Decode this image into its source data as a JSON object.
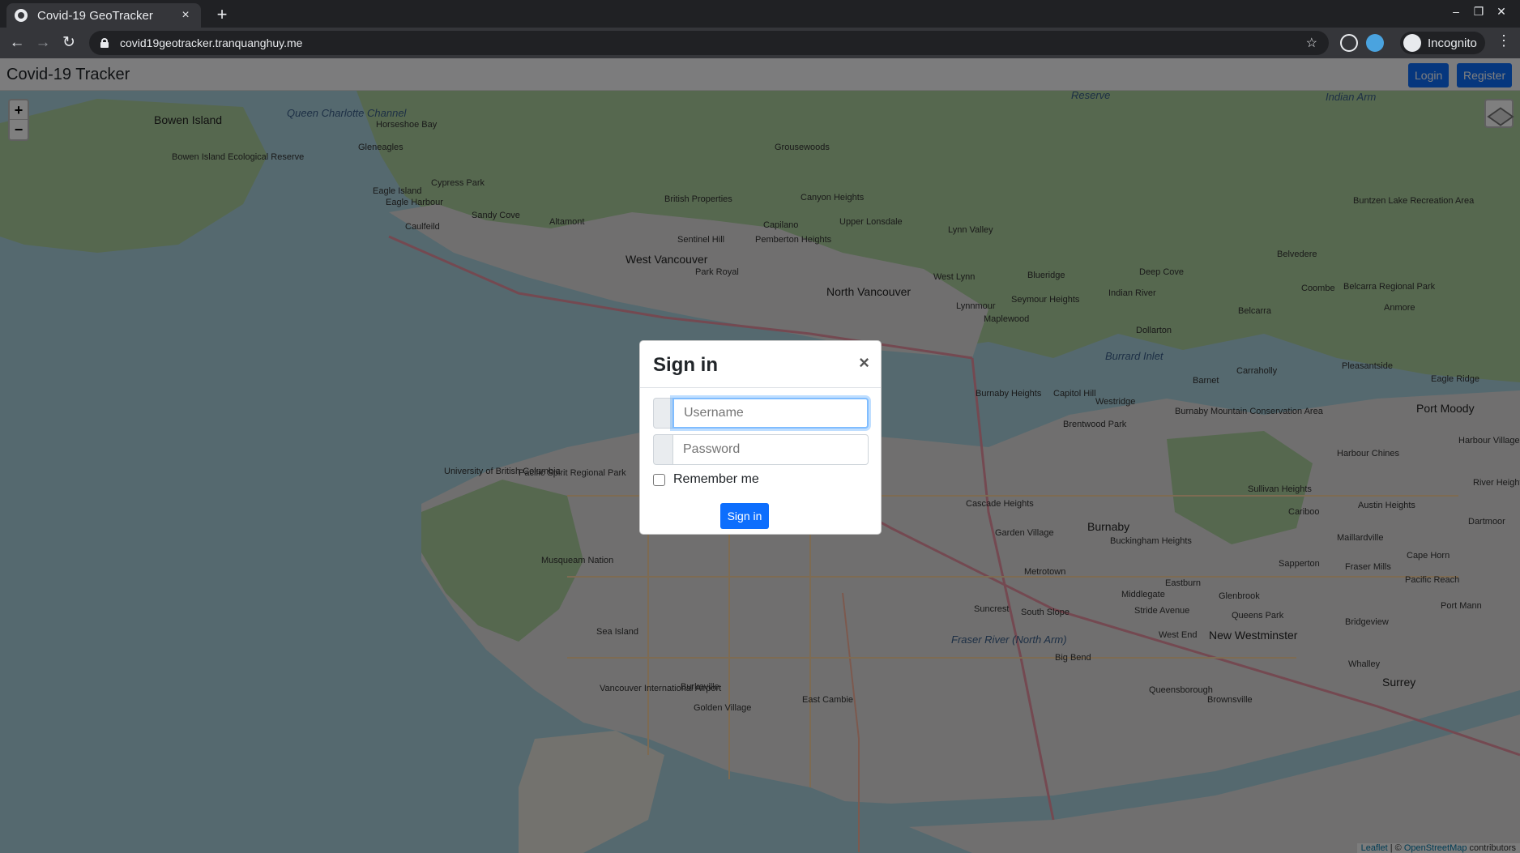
{
  "browser": {
    "tab_title": "Covid-19 GeoTracker",
    "tab_close": "×",
    "new_tab": "+",
    "url": "covid19geotracker.tranquanghuy.me",
    "profile_label": "Incognito"
  },
  "navbar": {
    "brand": "Covid-19 Tracker",
    "login_label": "Login",
    "register_label": "Register"
  },
  "map": {
    "zoom_in": "+",
    "zoom_out": "−",
    "attribution_leaflet": "Leaflet",
    "attribution_sep": " | © ",
    "attribution_osm": "OpenStreetMap",
    "attribution_tail": " contributors",
    "labels": [
      {
        "text": "Bowen Island",
        "kind": "big"
      },
      {
        "text": "Queen Charlotte Channel",
        "kind": "water"
      },
      {
        "text": "Horseshoe Bay",
        "kind": "normal"
      },
      {
        "text": "Gleneagles",
        "kind": "normal"
      },
      {
        "text": "Cypress Park",
        "kind": "normal"
      },
      {
        "text": "Eagle Island",
        "kind": "normal"
      },
      {
        "text": "Eagle Harbour",
        "kind": "normal"
      },
      {
        "text": "Caulfeild",
        "kind": "normal"
      },
      {
        "text": "Sandy Cove",
        "kind": "normal"
      },
      {
        "text": "Altamont",
        "kind": "normal"
      },
      {
        "text": "Grousewoods",
        "kind": "normal"
      },
      {
        "text": "British Properties",
        "kind": "normal"
      },
      {
        "text": "Canyon Heights",
        "kind": "normal"
      },
      {
        "text": "Capilano",
        "kind": "normal"
      },
      {
        "text": "Upper Lonsdale",
        "kind": "normal"
      },
      {
        "text": "Sentinel Hill",
        "kind": "normal"
      },
      {
        "text": "Pemberton Heights",
        "kind": "normal"
      },
      {
        "text": "Lynn Valley",
        "kind": "normal"
      },
      {
        "text": "West Vancouver",
        "kind": "big"
      },
      {
        "text": "Park Royal",
        "kind": "normal"
      },
      {
        "text": "North Vancouver",
        "kind": "big"
      },
      {
        "text": "West Lynn",
        "kind": "normal"
      },
      {
        "text": "Lynnmour",
        "kind": "normal"
      },
      {
        "text": "Maplewood",
        "kind": "normal"
      },
      {
        "text": "Blueridge",
        "kind": "normal"
      },
      {
        "text": "Seymour Heights",
        "kind": "normal"
      },
      {
        "text": "Indian River",
        "kind": "normal"
      },
      {
        "text": "Deep Cove",
        "kind": "normal"
      },
      {
        "text": "Belvedere",
        "kind": "normal"
      },
      {
        "text": "Coombe",
        "kind": "normal"
      },
      {
        "text": "Belcarra",
        "kind": "normal"
      },
      {
        "text": "Anmore",
        "kind": "normal"
      },
      {
        "text": "Dollarton",
        "kind": "normal"
      },
      {
        "text": "Burrard Inlet",
        "kind": "water"
      },
      {
        "text": "Pleasantside",
        "kind": "normal"
      },
      {
        "text": "Carraholly",
        "kind": "normal"
      },
      {
        "text": "Barnet",
        "kind": "normal"
      },
      {
        "text": "Eagle Ridge",
        "kind": "normal"
      },
      {
        "text": "Port Moody",
        "kind": "big"
      },
      {
        "text": "Burnaby Heights",
        "kind": "normal"
      },
      {
        "text": "Capitol Hill",
        "kind": "normal"
      },
      {
        "text": "Westridge",
        "kind": "normal"
      },
      {
        "text": "Brentwood Park",
        "kind": "normal"
      },
      {
        "text": "Harbour Chines",
        "kind": "normal"
      },
      {
        "text": "Harbour Village",
        "kind": "normal"
      },
      {
        "text": "River Heights",
        "kind": "normal"
      },
      {
        "text": "Sullivan Heights",
        "kind": "normal"
      },
      {
        "text": "Cariboo",
        "kind": "normal"
      },
      {
        "text": "Austin Heights",
        "kind": "normal"
      },
      {
        "text": "Dartmoor",
        "kind": "normal"
      },
      {
        "text": "Cascade Heights",
        "kind": "normal"
      },
      {
        "text": "Burnaby",
        "kind": "big"
      },
      {
        "text": "Garden Village",
        "kind": "normal"
      },
      {
        "text": "Buckingham Heights",
        "kind": "normal"
      },
      {
        "text": "Maillardville",
        "kind": "normal"
      },
      {
        "text": "Cape Horn",
        "kind": "normal"
      },
      {
        "text": "Sapperton",
        "kind": "normal"
      },
      {
        "text": "Fraser Mills",
        "kind": "normal"
      },
      {
        "text": "Pacific Reach",
        "kind": "normal"
      },
      {
        "text": "Metrotown",
        "kind": "normal"
      },
      {
        "text": "Eastburn",
        "kind": "normal"
      },
      {
        "text": "Middlegate",
        "kind": "normal"
      },
      {
        "text": "Glenbrook",
        "kind": "normal"
      },
      {
        "text": "Stride Avenue",
        "kind": "normal"
      },
      {
        "text": "Queens Park",
        "kind": "normal"
      },
      {
        "text": "Suncrest",
        "kind": "normal"
      },
      {
        "text": "South Slope",
        "kind": "normal"
      },
      {
        "text": "West End",
        "kind": "normal"
      },
      {
        "text": "New Westminster",
        "kind": "big"
      },
      {
        "text": "Bridgeview",
        "kind": "normal"
      },
      {
        "text": "Port Mann",
        "kind": "normal"
      },
      {
        "text": "Big Bend",
        "kind": "normal"
      },
      {
        "text": "Whalley",
        "kind": "normal"
      },
      {
        "text": "Surrey",
        "kind": "big"
      },
      {
        "text": "Queensborough",
        "kind": "normal"
      },
      {
        "text": "Brownsville",
        "kind": "normal"
      },
      {
        "text": "Sea Island",
        "kind": "normal"
      },
      {
        "text": "Burkeville",
        "kind": "normal"
      },
      {
        "text": "East Cambie",
        "kind": "normal"
      },
      {
        "text": "Golden Village",
        "kind": "normal"
      },
      {
        "text": "University of British Columbia",
        "kind": "normal"
      },
      {
        "text": "Pacific Spirit Regional Park",
        "kind": "normal"
      },
      {
        "text": "Musqueam Nation",
        "kind": "normal"
      },
      {
        "text": "Vancouver International Airport",
        "kind": "normal"
      },
      {
        "text": "Fraser River (North Arm)",
        "kind": "water"
      },
      {
        "text": "Reserve",
        "kind": "water"
      },
      {
        "text": "Indian Arm",
        "kind": "water"
      },
      {
        "text": "Buntzen Lake Recreation Area",
        "kind": "normal"
      },
      {
        "text": "Burnaby Mountain Conservation Area",
        "kind": "normal"
      },
      {
        "text": "Belcarra Regional Park",
        "kind": "normal"
      },
      {
        "text": "Bowen Island Ecological Reserve",
        "kind": "normal"
      }
    ]
  },
  "modal": {
    "title": "Sign in",
    "close": "×",
    "username_placeholder": "Username",
    "password_placeholder": "Password",
    "remember_label": "Remember me",
    "submit_label": "Sign in"
  },
  "colors": {
    "primary": "#0d6efd",
    "chrome_dark": "#202124",
    "chrome_toolbar": "#35363a"
  }
}
